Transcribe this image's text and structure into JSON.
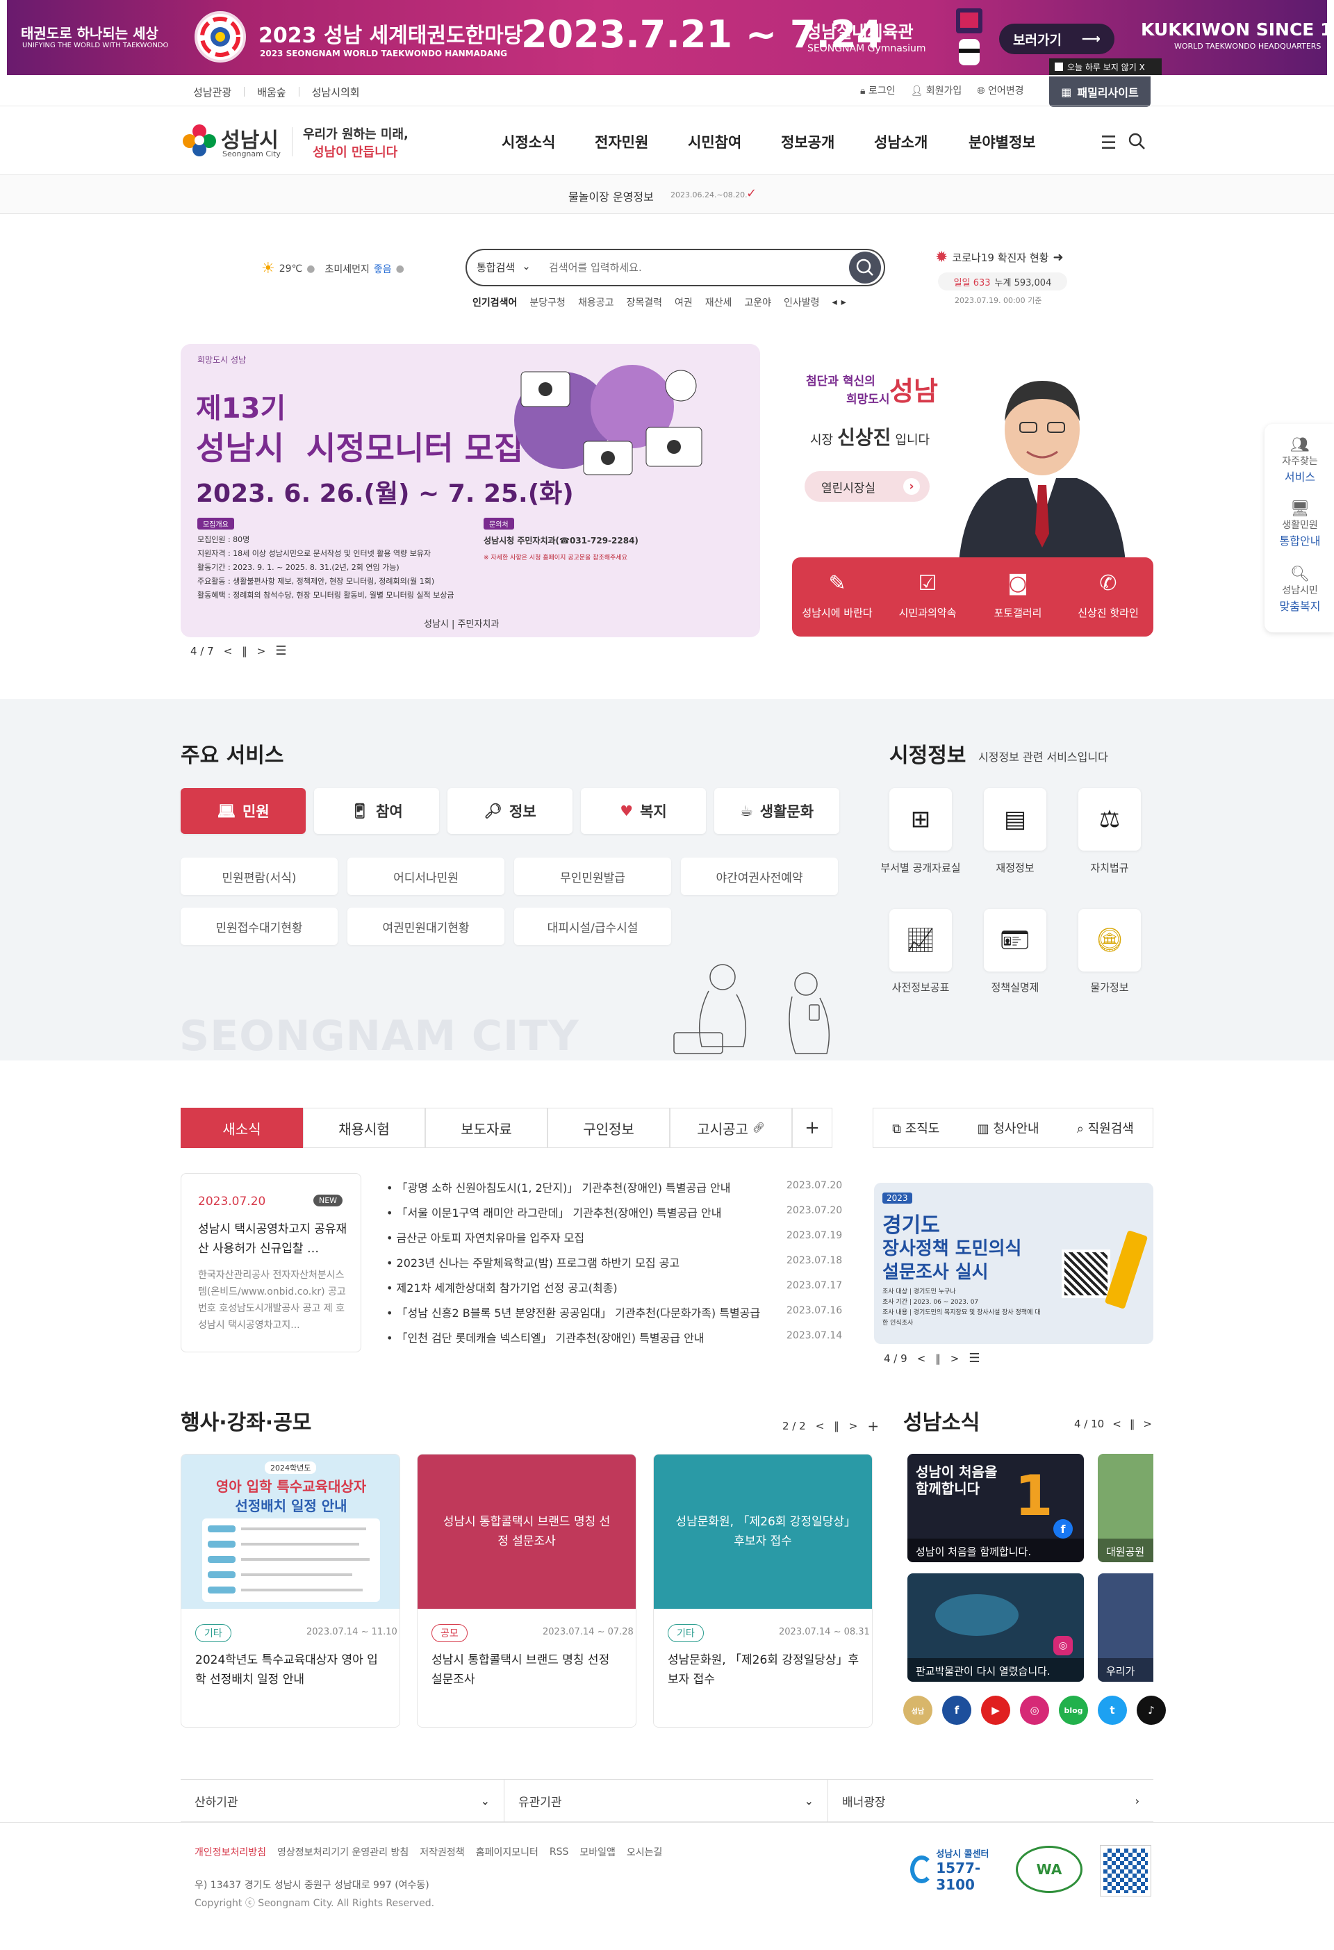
{
  "banner": {
    "left_line1": "태권도로 하나되는 세상",
    "left_line2": "UNIFYING THE WORLD WITH TAEKWONDO",
    "title_ko": "2023 성남 세계태권도한마당",
    "title_en": "2023 SEONGNAM WORLD TAEKWONDO HANMADANG",
    "dates": "2023.7.21 ~ 7.24",
    "venue_ko": "성남실내체육관",
    "venue_en": "SEONGNAM Gymnasium",
    "view_button": "보러가기",
    "kukkiwon": "KUKKIWON SINCE 1972",
    "kukkiwon_sub": "WORLD TAEKWONDO HEADQUARTERS",
    "hide_today": "오늘 하루 보지 않기 X"
  },
  "util": {
    "left": [
      "성남관광",
      "배움숲",
      "성남시의회"
    ],
    "login": "로그인",
    "join": "회원가입",
    "lang": "언어변경",
    "family": "패밀리사이트"
  },
  "header": {
    "logo": "성남시",
    "logo_en": "Seongnam City",
    "slogan_1": "우리가 원하는 미래,",
    "slogan_2": "성남이 만듭니다",
    "gnb": [
      "시정소식",
      "전자민원",
      "시민참여",
      "정보공개",
      "성남소개",
      "분야별정보"
    ]
  },
  "noticebar": {
    "text": "물놀이장 운영정보",
    "date": "2023.06.24.~08.20."
  },
  "weather": {
    "temp": "29℃",
    "dust_label": "초미세먼지",
    "dust_value": "좋음"
  },
  "search": {
    "category": "통합검색",
    "placeholder": "검색어를 입력하세요.",
    "popular_label": "인기검색어",
    "keywords": [
      "분당구청",
      "채용공고",
      "장목결력",
      "여권",
      "재산세",
      "고운야",
      "인사발령"
    ]
  },
  "covid": {
    "title": "코로나19 확진자 현황",
    "daily": "일일 633",
    "total": "누계 593,004",
    "stamp": "2023.07.19. 00:00 기준"
  },
  "visual": {
    "brand": "희망도시 성남",
    "title1": "제13기",
    "title2": "성남시  시정모니터 모집",
    "period": "2023. 6. 26.(월) ~ 7. 25.(화)",
    "box1": "모집개요",
    "box2": "문의처",
    "details": [
      "모집인원 : 80명",
      "지원자격 : 18세 이상 성남시민으로 문서작성 및 인터넷 활용 역량 보유자",
      "활동기간 : 2023. 9. 1. ~ 2025. 8. 31.(2년, 2회 연임 가능)",
      "주요활동 : 생활불편사항 제보, 정책제안, 현장 모니터링, 정례회의(월 1회)",
      "활동혜택 : 정례회의 참석수당, 현장 모니터링 활동비, 월별 모니터링 실적 보상금"
    ],
    "contact": "성남시청 주민자치과(☎031-729-2284)",
    "contact_note": "※ 자세한 사항은 시청 홈페이지 공고문을 참조해주세요",
    "dept": "성남시 | 주민자치과",
    "pager": "4 / 7"
  },
  "mayor": {
    "tagline_a": "첨단과 혁신의",
    "tagline_b": "희망도시",
    "city": "성남",
    "title_pre": "시장",
    "name": "신상진",
    "title_post": "입니다",
    "open_button": "열린시장실",
    "quick": [
      "성남시에 바란다",
      "시민과의약속",
      "포토갤러리",
      "신상진 핫라인"
    ]
  },
  "side": [
    {
      "l1": "자주찾는",
      "l2": "서비스"
    },
    {
      "l1": "생활민원",
      "l2": "통합안내"
    },
    {
      "l1": "성남시민",
      "l2": "맞춤복지"
    }
  ],
  "services": {
    "title": "주요 서비스",
    "tabs": [
      "민원",
      "참여",
      "정보",
      "복지",
      "생활문화"
    ],
    "buttons": [
      "민원편람(서식)",
      "어디서나민원",
      "무인민원발급",
      "야간여권사전예약",
      "민원접수대기현황",
      "여권민원대기현황",
      "대피시설/급수시설"
    ],
    "bg_text": "SEONGNAM CITY"
  },
  "cityinfo": {
    "title": "시정정보",
    "subtitle": "시정정보 관련 서비스입니다",
    "items": [
      "부서별 공개자료실",
      "재정정보",
      "자치법규",
      "사전정보공표",
      "정책실명제",
      "물가정보"
    ]
  },
  "news": {
    "tabs": [
      "새소식",
      "채용시험",
      "보도자료",
      "구인정보",
      "고시공고"
    ],
    "plus": "+",
    "org": [
      "조직도",
      "청사안내",
      "직원검색"
    ],
    "featured": {
      "date": "2023.07.20",
      "badge": "NEW",
      "title": "성남시 택시공영차고지 공유재산 사용허가 신규입찰 …",
      "body": "한국자산관리공사 전자자산처분시스템(온비드/www.onbid.co.kr) 공고번호 호성남도시개발공사 공고 제 호성남시 택시공영차고지..."
    },
    "items": [
      {
        "t": "「광명 소하 신원아침도시(1, 2단지)」 기관추천(장애인) 특별공급 안내",
        "d": "2023.07.20"
      },
      {
        "t": "「서울 이문1구역 래미안 라그란데」 기관추천(장애인) 특별공급 안내",
        "d": "2023.07.20"
      },
      {
        "t": "금산군 아토피 자연치유마을 입주자 모집",
        "d": "2023.07.19"
      },
      {
        "t": "2023년 신나는 주말체육학교(밤) 프로그램 하반기 모집 공고",
        "d": "2023.07.18"
      },
      {
        "t": "제21차 세계한상대회 참가기업 선정 공고(최종)",
        "d": "2023.07.17"
      },
      {
        "t": "「성남 신흥2 B블록 5년 분양전환 공공임대」 기관추천(다문화가족) 특별공급 ...",
        "d": "2023.07.16"
      },
      {
        "t": "「인천 검단 롯데캐슬 넥스티엘」 기관추천(장애인) 특별공급 안내",
        "d": "2023.07.14"
      }
    ],
    "promo": {
      "year": "2023",
      "l1": "경기도",
      "l2": "장사정책 도민의식",
      "l3": "설문조사 실시",
      "note1": "조사 대상 | 경기도민 누구나",
      "note2": "조사 기간 | 2023. 06 ~ 2023. 07",
      "note3": "조사 내용 | 경기도민의 복지장묘 및 장사시설 장사 정책에 대한 인식조사"
    },
    "promo_pager": "4 / 9"
  },
  "events": {
    "title": "행사·강좌·공모",
    "pager": "2 / 2",
    "cards": [
      {
        "tag": "기타",
        "period": "2023.07.14 ~ 11.10",
        "title": "2024학년도 특수교육대상자 영아 입학 선정배치 일정 안내",
        "img_l1": "영아 입학 특수교육대상자",
        "img_l2": "선정배치 일정 안내",
        "img_top": "2024학년도"
      },
      {
        "tag": "공모",
        "period": "2023.07.14 ~ 07.28",
        "title": "성남시 통합콜택시 브랜드 명칭 선정 설문조사",
        "img": "성남시 통합콜택시 브랜드 명칭 선정 설문조사"
      },
      {
        "tag": "기타",
        "period": "2023.07.14 ~ 08.31",
        "title": "성남문화원, 「제26회 강정일당상」후보자 접수",
        "img": "성남문화원, 「제26회 강정일당상」후보자 접수"
      }
    ]
  },
  "sns": {
    "title": "성남소식",
    "pager": "4 / 10",
    "cards": [
      "성남이 처음을 함께합니다.",
      "대원공원",
      "판교박물관이 다시 열렸습니다.",
      "우리가"
    ],
    "card1_big": "성남이 처음을 함께합니다",
    "icons": [
      "f",
      "▶",
      "◎",
      "blog",
      "t",
      "♪"
    ]
  },
  "footer": {
    "selects": [
      "산하기관",
      "유관기관",
      "배너광장"
    ],
    "links": [
      "개인정보처리방침",
      "영상정보처리기기 운영관리 방침",
      "저작권정책",
      "홈페이지모니터",
      "RSS",
      "모바일앱",
      "오시는길"
    ],
    "address": "우) 13437 경기도 성남시 중원구 성남대로 997 (여수동)",
    "copyright": "Copyright ⓒ Seongnam City. All Rights Reserved.",
    "callcenter": "성남시 콜센터",
    "callnum": "1577-3100"
  },
  "colors": {
    "accent": "#d73a4b",
    "banner": "#b42a7b"
  }
}
